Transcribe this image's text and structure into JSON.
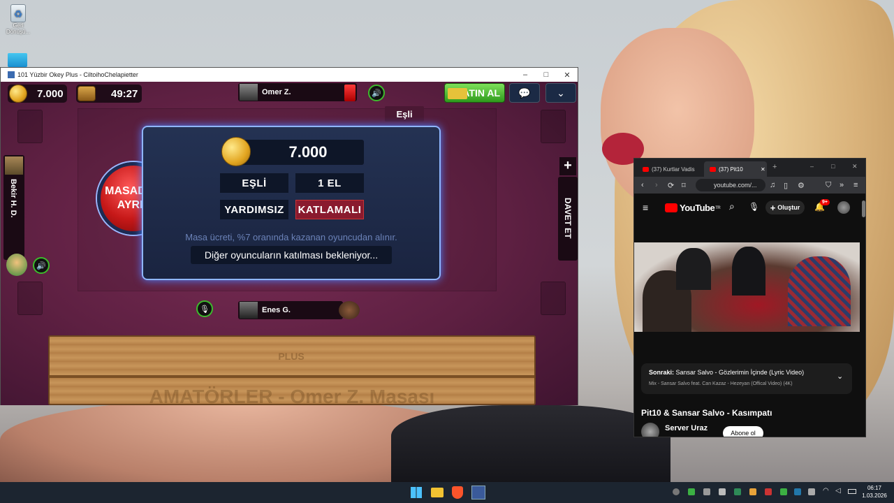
{
  "desktop": {
    "recycle_bin_label": "Geri Dönüşü..."
  },
  "game_window": {
    "title": "101 Yüzbir Okey Plus - CiltoihoChelapietter"
  },
  "game": {
    "coins": "7.000",
    "timer": "49:27",
    "buy_label": "SATIN AL",
    "partner_tag": "Eşli",
    "invite_label": "DAVET ET",
    "players": {
      "top": "Omer Z.",
      "left": "Bekir H. D.",
      "bottom": "Enes G."
    },
    "panel": {
      "stake": "7.000",
      "opt_partner": "EŞLİ",
      "opt_rounds": "1 EL",
      "opt_help": "YARDIMSIZ",
      "opt_mode": "KATLAMALI",
      "fee_text": "Masa ücreti, %7 oranında kazanan oyuncudan alınır.",
      "waiting_text": "Diğer oyuncuların katılması bekleniyor..."
    },
    "leave_line1": "MASADAN",
    "leave_line2": "AYRIL",
    "rack_logo": "PLUS",
    "rack_text": "AMATÖRLER - Omer Z. Masası"
  },
  "browser": {
    "tab1": "(37) Kurtlar Vadis",
    "tab2": "(37) Pit10",
    "url": "youtube.com/...",
    "yt_logo": "YouTube",
    "yt_region": "TR",
    "create_label": "Oluştur",
    "notif_count": "9+",
    "next_label": "Sonraki:",
    "next_title": "Sansar Salvo - Gözlerimin İçinde (Lyric Video)",
    "mix_text": "Mix - Sansar Salvo feat. Can Kazaz - Hezeyan (Offical Video) (4K)",
    "video_title": "Pit10 & Sansar Salvo - Kasımpatı",
    "channel": "Server Uraz",
    "subscribe_label": "Abone ol"
  },
  "taskbar": {
    "time": "06:17",
    "date": "1.03.2026"
  },
  "colors": {
    "panel_border": "#8fb6ff",
    "buy_green": "#49b82e",
    "leave_red": "#c61818",
    "mode_red": "#8a1a2e"
  }
}
